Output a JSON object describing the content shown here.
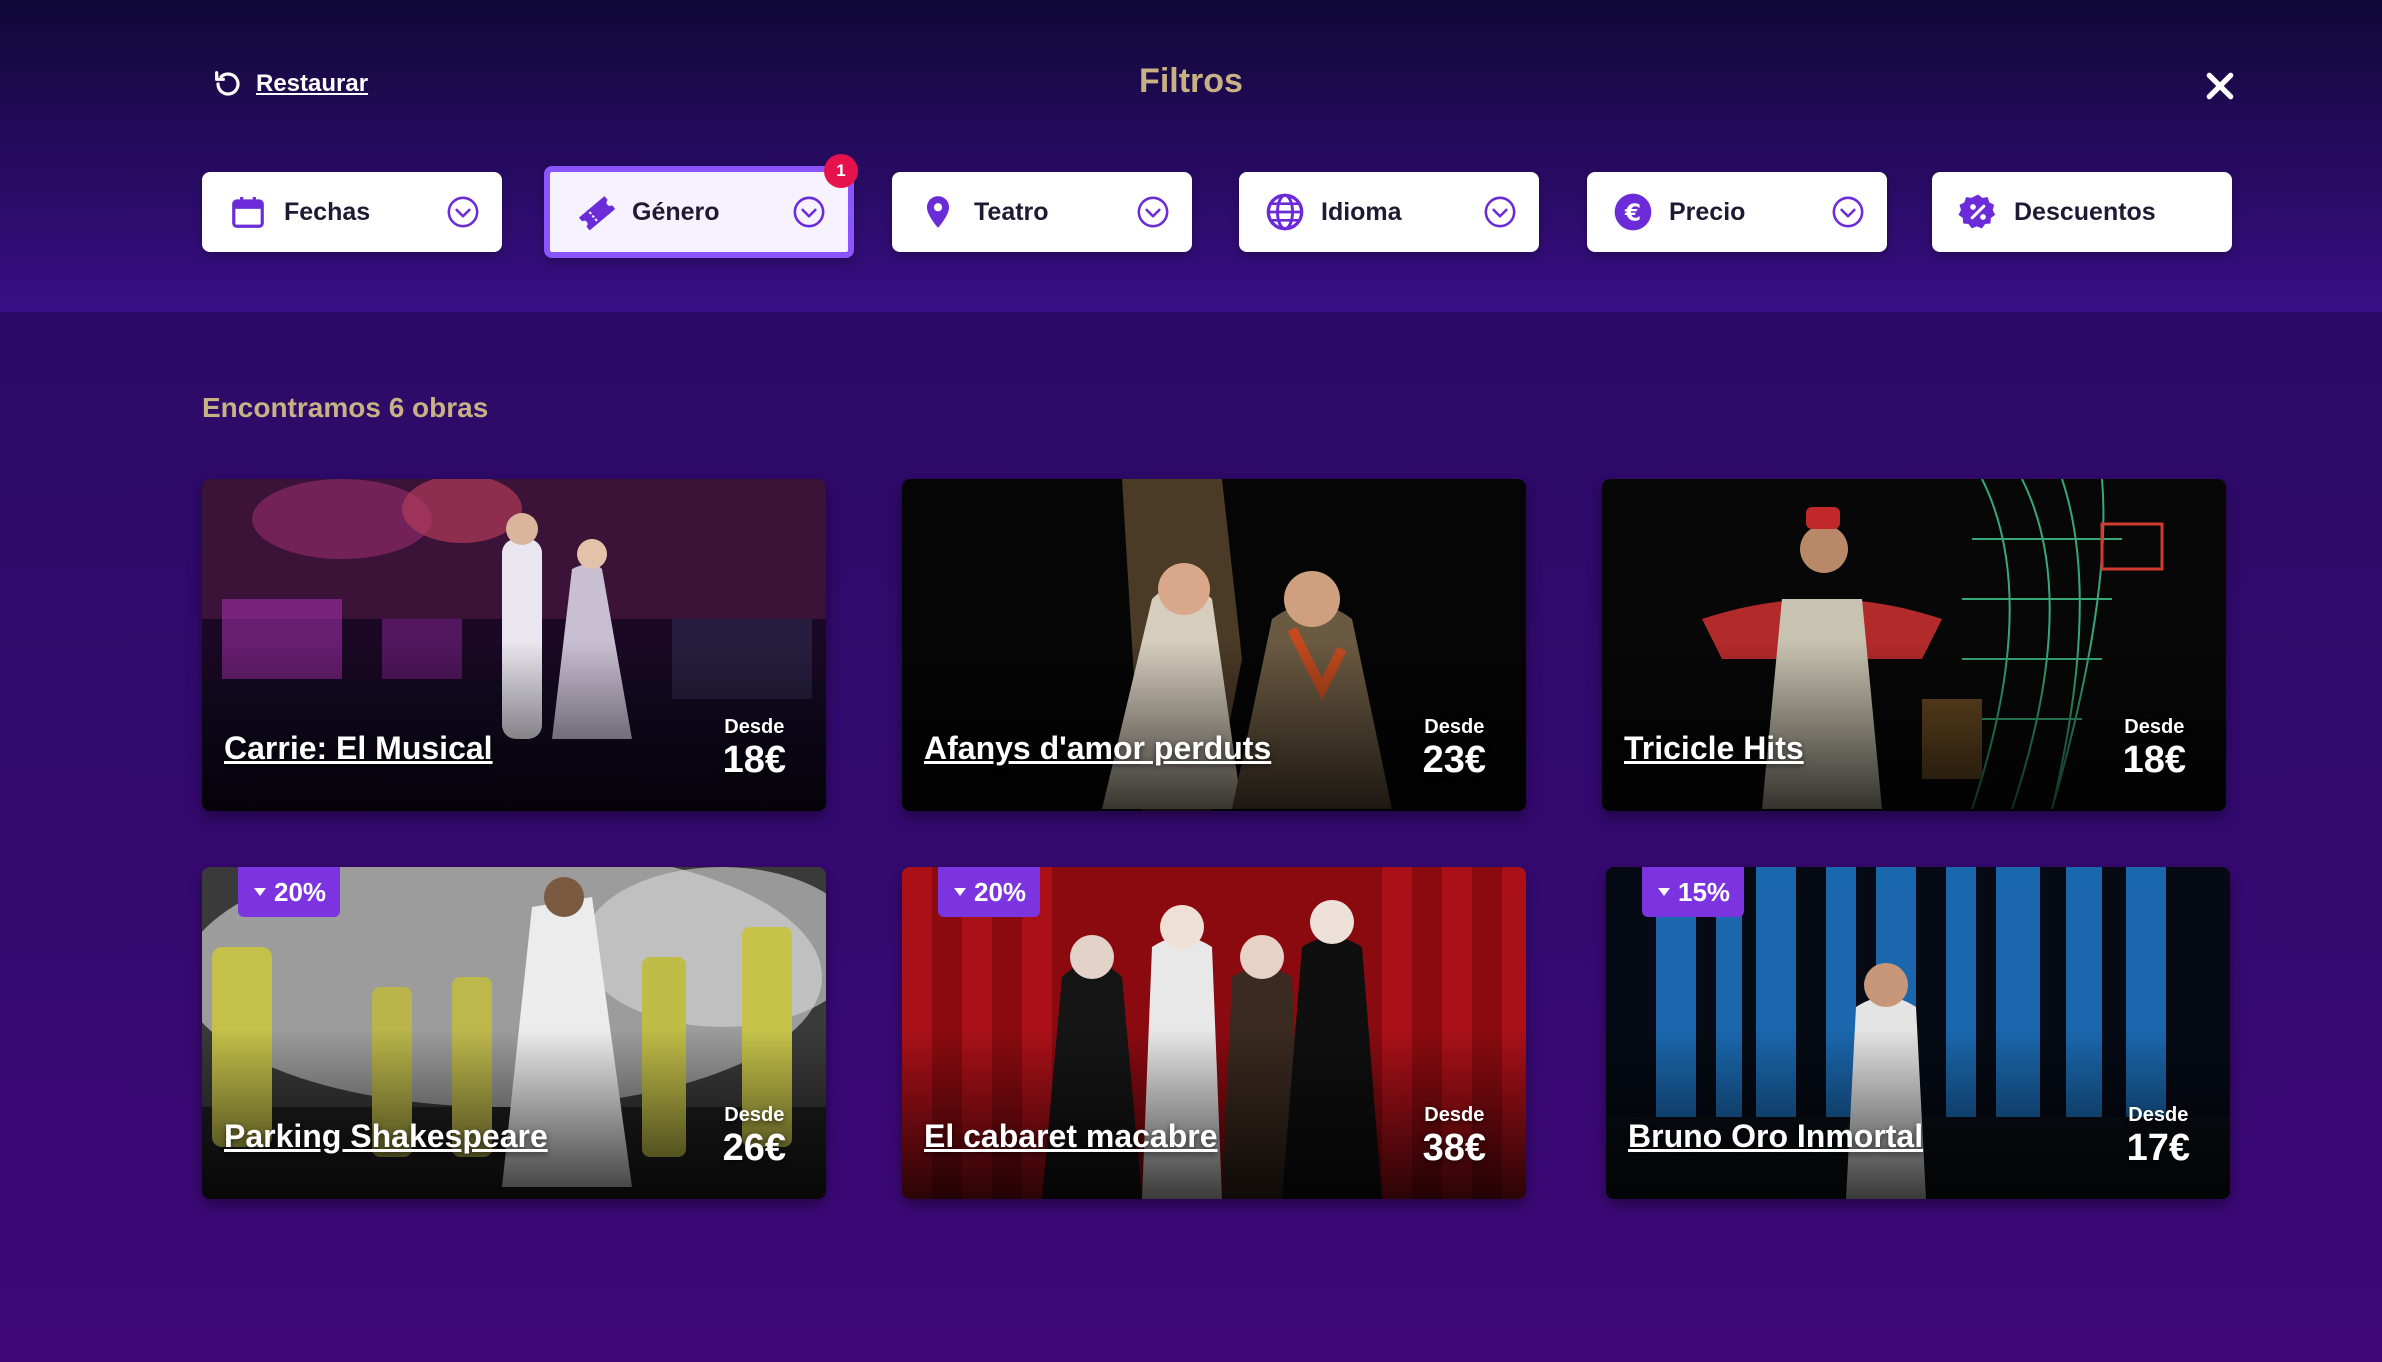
{
  "header": {
    "restore_label": "Restaurar",
    "title": "Filtros"
  },
  "filters": [
    {
      "label": "Fechas",
      "icon": "calendar-icon",
      "has_chevron": true,
      "active": false
    },
    {
      "label": "Género",
      "icon": "ticket-icon",
      "has_chevron": true,
      "active": true,
      "badge": "1"
    },
    {
      "label": "Teatro",
      "icon": "location-pin-icon",
      "has_chevron": true,
      "active": false
    },
    {
      "label": "Idioma",
      "icon": "globe-icon",
      "has_chevron": true,
      "active": false
    },
    {
      "label": "Precio",
      "icon": "euro-icon",
      "has_chevron": true,
      "active": false
    },
    {
      "label": "Descuentos",
      "icon": "discount-badge-icon",
      "has_chevron": false,
      "active": false
    }
  ],
  "results": {
    "count_text": "Encontramos 6 obras",
    "from_label": "Desde",
    "cards": [
      {
        "title": "Carrie: El Musical",
        "price": "18€",
        "discount": null
      },
      {
        "title": "Afanys d'amor perduts",
        "price": "23€",
        "discount": null
      },
      {
        "title": "Tricicle Hits",
        "price": "18€",
        "discount": null
      },
      {
        "title": "Parking Shakespeare",
        "price": "26€",
        "discount": "20%"
      },
      {
        "title": "El cabaret macabre",
        "price": "38€",
        "discount": "20%"
      },
      {
        "title": "Bruno Oro Inmortal",
        "price": "17€",
        "discount": "15%"
      }
    ]
  },
  "colors": {
    "accent": "#8a55ff",
    "title_gold": "#c8b183",
    "badge_red": "#e6124d",
    "discount_purple": "#7b34e0",
    "icon_purple": "#6c2bd9"
  }
}
